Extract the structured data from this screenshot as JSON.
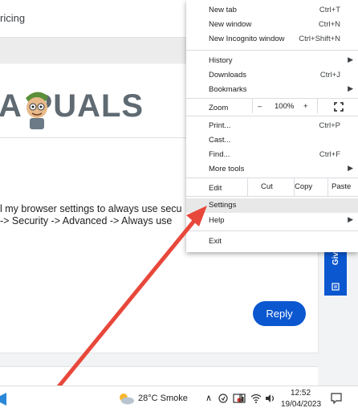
{
  "page": {
    "top_text": "ricing",
    "logo_text": "A  PUALS",
    "post_lines": [
      "l my browser settings to always use secu",
      " -> Security -> Advanced -> Always use"
    ],
    "reply_label": "Reply",
    "give_feedback_label": "Give Fe"
  },
  "menu": {
    "new_tab": {
      "label": "New tab",
      "shortcut": "Ctrl+T"
    },
    "new_window": {
      "label": "New window",
      "shortcut": "Ctrl+N"
    },
    "new_incognito": {
      "label": "New Incognito window",
      "shortcut": "Ctrl+Shift+N"
    },
    "history": {
      "label": "History"
    },
    "downloads": {
      "label": "Downloads",
      "shortcut": "Ctrl+J"
    },
    "bookmarks": {
      "label": "Bookmarks"
    },
    "zoom": {
      "label": "Zoom",
      "minus": "–",
      "value": "100%",
      "plus": "+"
    },
    "print": {
      "label": "Print...",
      "shortcut": "Ctrl+P"
    },
    "cast": {
      "label": "Cast..."
    },
    "find": {
      "label": "Find...",
      "shortcut": "Ctrl+F"
    },
    "more_tools": {
      "label": "More tools"
    },
    "edit": {
      "label": "Edit",
      "cut": "Cut",
      "copy": "Copy",
      "paste": "Paste"
    },
    "settings": {
      "label": "Settings"
    },
    "help": {
      "label": "Help"
    },
    "exit": {
      "label": "Exit"
    }
  },
  "taskbar": {
    "weather": "28°C  Smoke",
    "time": "12:52",
    "date": "19/04/2023"
  },
  "colors": {
    "accent": "#0b57d0",
    "arrow": "#e8483b"
  }
}
